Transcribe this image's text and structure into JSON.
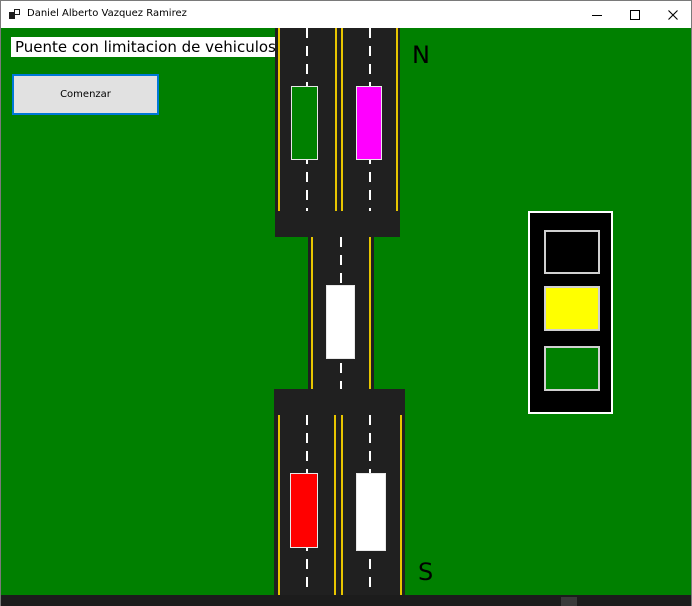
{
  "window": {
    "title": "Daniel Alberto Vazquez Ramirez",
    "app_icon": "windows-form-icon",
    "controls": {
      "minimize_icon": "minimize-icon",
      "maximize_icon": "maximize-icon",
      "close_icon": "close-icon"
    }
  },
  "form": {
    "heading": "Puente con limitacion de vehiculos",
    "start_button": "Comenzar",
    "north_label": "N",
    "south_label": "S",
    "background_color": "#008000"
  },
  "vehicles": [
    {
      "id": "north-left",
      "color": "#008000"
    },
    {
      "id": "north-right",
      "color": "#ff00ff"
    },
    {
      "id": "bridge",
      "color": "#ffffff"
    },
    {
      "id": "south-left",
      "color": "#ff0000"
    },
    {
      "id": "south-right",
      "color": "#ffffff"
    }
  ],
  "traffic_light": {
    "lamps": [
      {
        "position": "top",
        "color": "#000000"
      },
      {
        "position": "middle",
        "color": "#ffff00"
      },
      {
        "position": "bottom",
        "color": "#008000"
      }
    ]
  }
}
